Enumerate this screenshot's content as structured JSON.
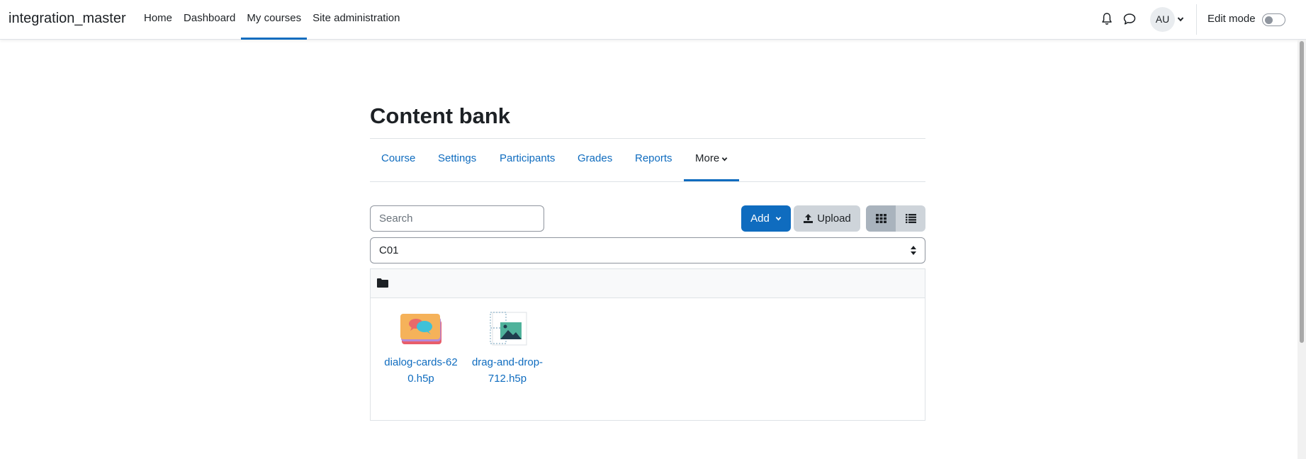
{
  "navbar": {
    "brand": "integration_master",
    "links": [
      "Home",
      "Dashboard",
      "My courses",
      "Site administration"
    ],
    "active_link": "My courses",
    "avatar_initials": "AU",
    "edit_mode_label": "Edit mode",
    "edit_mode_on": false
  },
  "page": {
    "title": "Content bank",
    "secondary_nav": [
      "Course",
      "Settings",
      "Participants",
      "Grades",
      "Reports"
    ],
    "more_label": "More"
  },
  "toolbar": {
    "search_placeholder": "Search",
    "add_label": "Add",
    "upload_label": "Upload",
    "view_mode": "grid"
  },
  "context_select": {
    "selected": "C01"
  },
  "files": [
    {
      "name": "dialog-cards-620.h5p",
      "line1": "dialog-cards-62",
      "line2": "0.h5p",
      "icon": "dialog-cards-icon"
    },
    {
      "name": "drag-and-drop-712.h5p",
      "line1": "drag-and-drop-",
      "line2": "712.h5p",
      "icon": "drag-and-drop-icon"
    }
  ],
  "colors": {
    "primary": "#0f6cbf",
    "secondary_button": "#ced4da",
    "text": "#1d2125"
  }
}
